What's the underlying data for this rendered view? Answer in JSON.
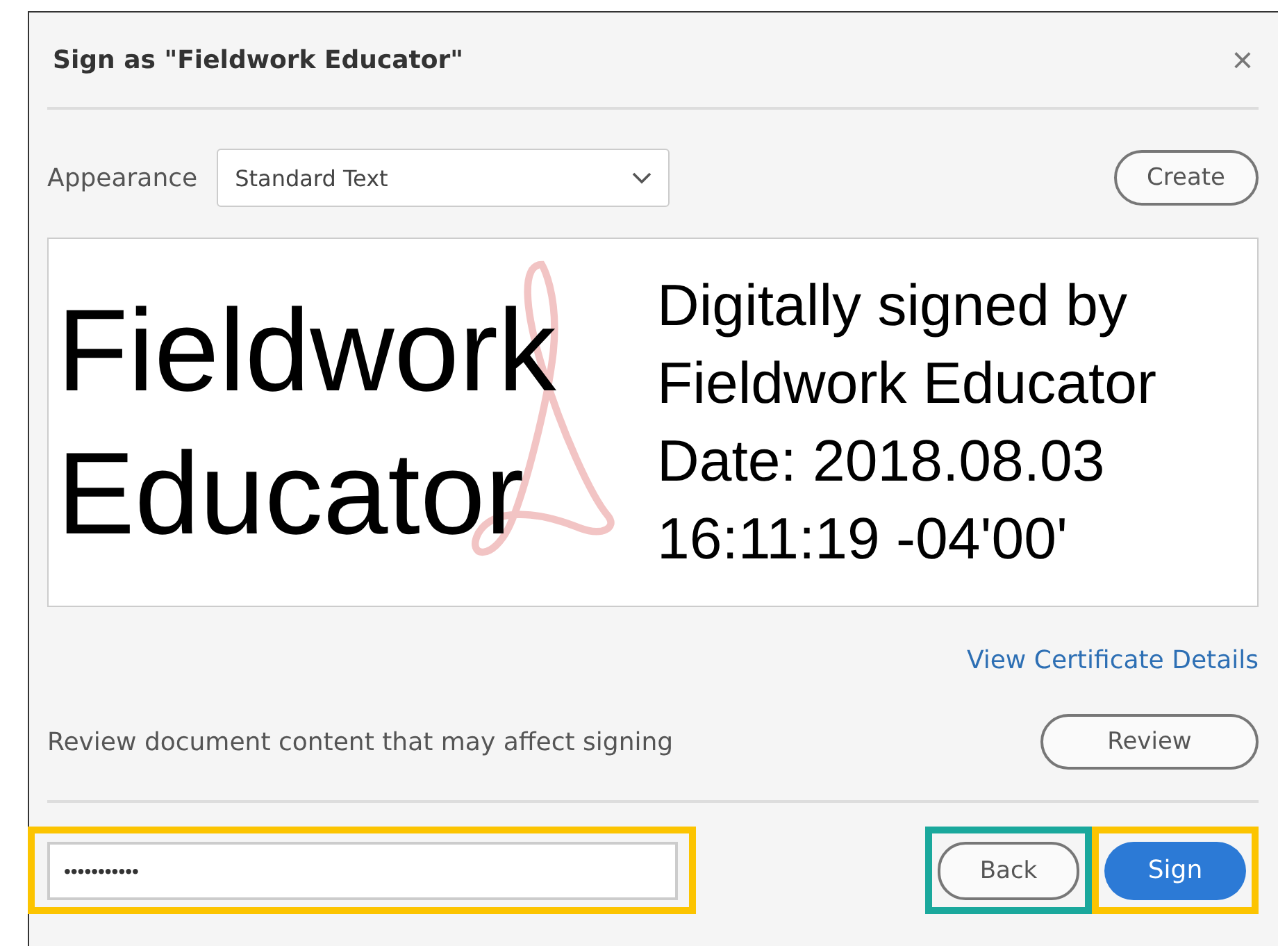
{
  "dialog": {
    "title": "Sign as \"Fieldwork Educator\"",
    "close": "×"
  },
  "appearance": {
    "label": "Appearance",
    "value": "Standard Text",
    "create_button": "Create"
  },
  "preview": {
    "name_lines": [
      "Fieldwork",
      "Educator"
    ],
    "detail_lines": [
      "Digitally signed by",
      "Fieldwork Educator",
      "Date: 2018.08.03",
      "16:11:19 -04'00'"
    ]
  },
  "certificate_link": "View Certificate Details",
  "review": {
    "text": "Review document content that may affect signing",
    "button": "Review"
  },
  "footer": {
    "password": {
      "value": "•••••••••••",
      "color": "#fcc400"
    },
    "back_button": {
      "label": "Back",
      "color": "#1aa89c"
    },
    "sign_button": {
      "label": "Sign",
      "color": "#fcc400"
    }
  }
}
